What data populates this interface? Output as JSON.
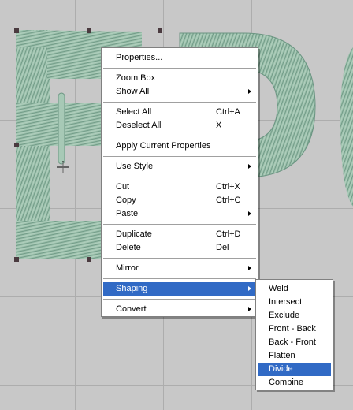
{
  "context_menu": {
    "groups": [
      [
        {
          "label": "Properties..."
        }
      ],
      [
        {
          "label": "Zoom Box"
        },
        {
          "label": "Show All",
          "submenu": true
        }
      ],
      [
        {
          "label": "Select All",
          "shortcut": "Ctrl+A"
        },
        {
          "label": "Deselect All",
          "shortcut": "X"
        }
      ],
      [
        {
          "label": "Apply Current Properties"
        }
      ],
      [
        {
          "label": "Use Style",
          "submenu": true
        }
      ],
      [
        {
          "label": "Cut",
          "shortcut": "Ctrl+X"
        },
        {
          "label": "Copy",
          "shortcut": "Ctrl+C"
        },
        {
          "label": "Paste",
          "submenu": true
        }
      ],
      [
        {
          "label": "Duplicate",
          "shortcut": "Ctrl+D"
        },
        {
          "label": "Delete",
          "shortcut": "Del"
        }
      ],
      [
        {
          "label": "Mirror",
          "submenu": true
        }
      ],
      [
        {
          "label": "Shaping",
          "submenu": true,
          "highlighted": true
        }
      ],
      [
        {
          "label": "Convert",
          "submenu": true
        }
      ]
    ]
  },
  "shaping_submenu": {
    "items": [
      {
        "label": "Weld"
      },
      {
        "label": "Intersect"
      },
      {
        "label": "Exclude"
      },
      {
        "label": "Front - Back"
      },
      {
        "label": "Back - Front"
      },
      {
        "label": "Flatten"
      },
      {
        "label": "Divide",
        "highlighted": true
      },
      {
        "label": "Combine"
      }
    ]
  },
  "colors": {
    "canvas": "#c8c8c8",
    "grid": "#adadad",
    "stitch": "#8fb5a0",
    "stitch_dark": "#6b9582",
    "highlight": "#316ac5"
  },
  "icons": [
    "move-cursor-icon",
    "submenu-arrow-icon"
  ]
}
